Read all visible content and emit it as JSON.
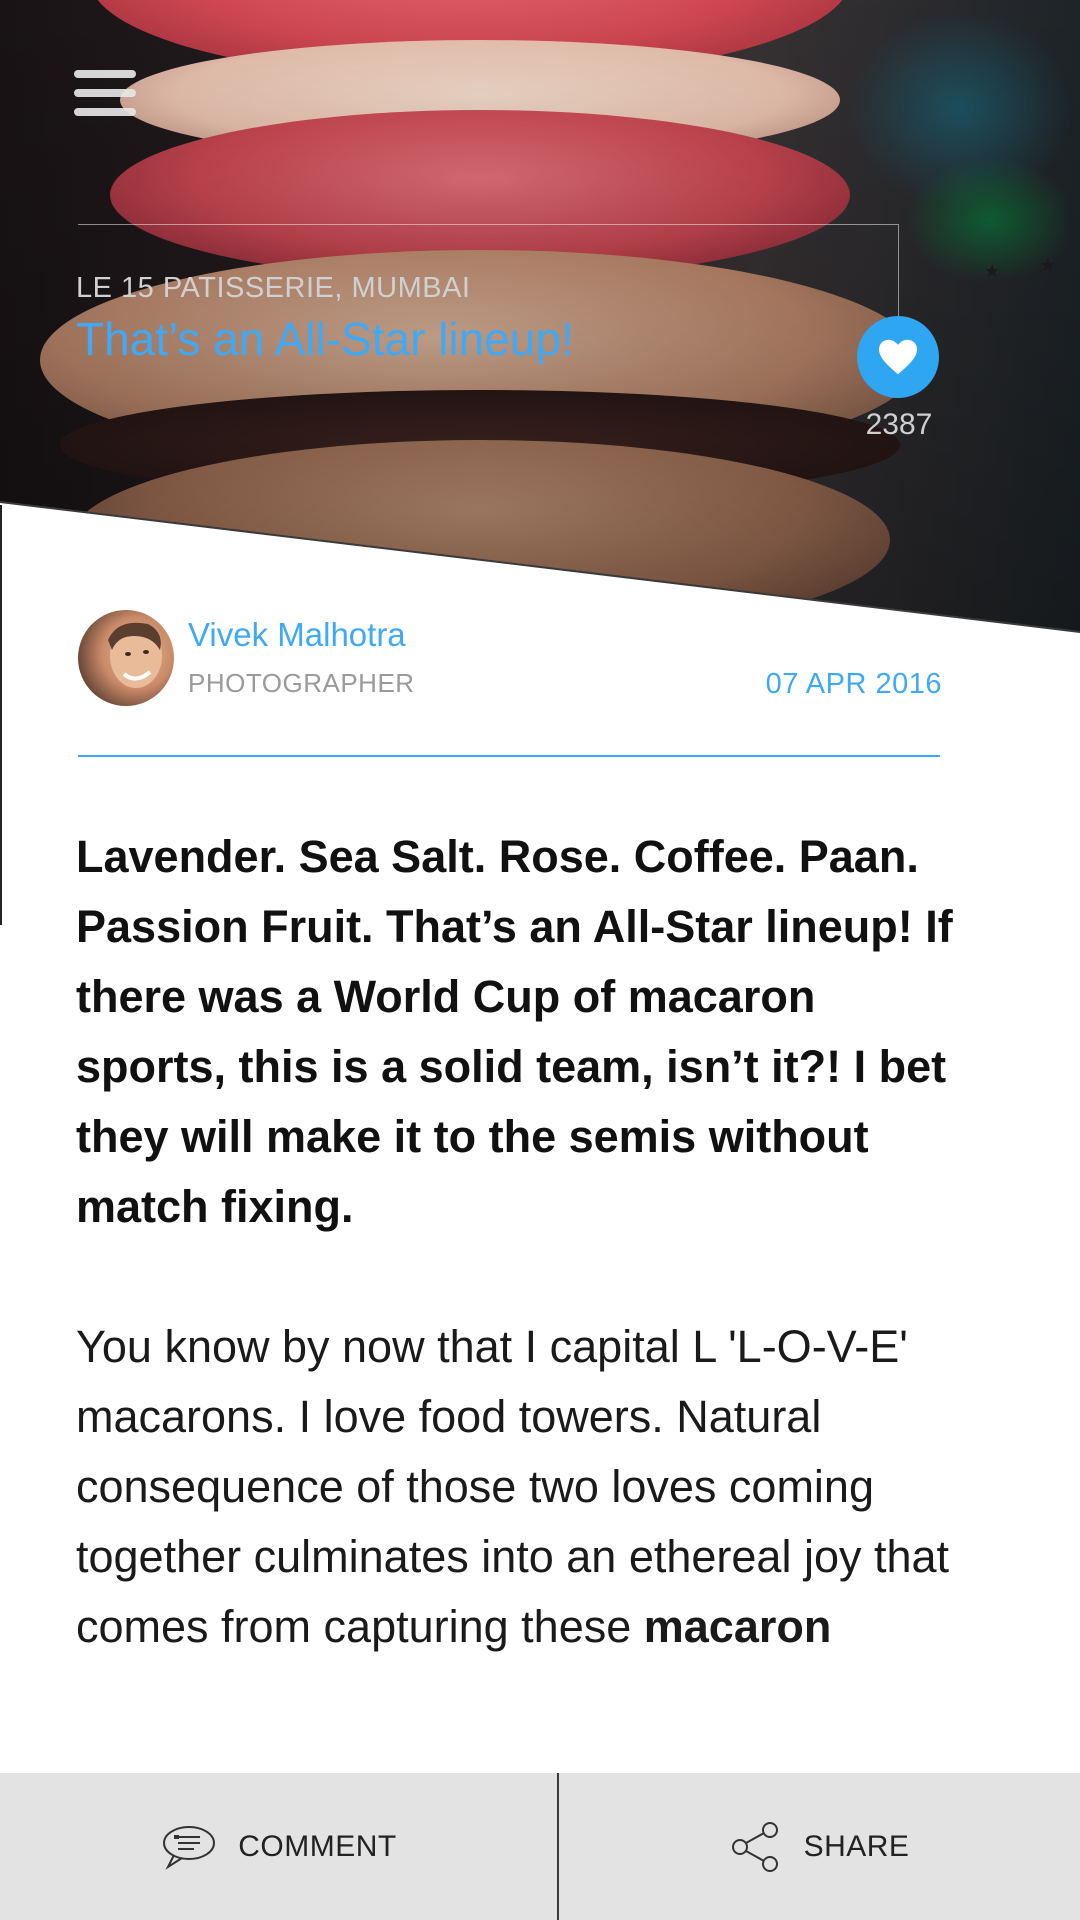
{
  "header": {
    "location": "LE 15 PATISSERIE, MUMBAI",
    "title": "That’s an All-Star lineup!",
    "like_count": "2387",
    "menu_icon": "hamburger-menu-icon",
    "like_icon": "heart-icon"
  },
  "author": {
    "name": "Vivek Malhotra",
    "role": "PHOTOGRAPHER",
    "date": "07 APR 2016"
  },
  "article": {
    "lead": "Lavender. Sea Salt. Rose. Coffee. Paan. Passion Fruit. That’s an All-Star lineup! If there was a World Cup of macaron sports, this is a solid team, isn’t it?! I bet they will make it to the semis without match fixing.",
    "body": "You know by now that I capital L 'L-O-V-E' macarons. I love food towers. Natural consequence of those two loves coming together culminates into an ethereal joy that comes from capturing these",
    "body_bold_tail": "macaron"
  },
  "bottom_bar": {
    "comment_label": "COMMENT",
    "share_label": "SHARE",
    "comment_icon": "comment-icon",
    "share_icon": "share-icon"
  },
  "colors": {
    "accent": "#3fa9f5",
    "like_button": "#2fa6f2",
    "bottom_bar": "#e3e3e3"
  }
}
